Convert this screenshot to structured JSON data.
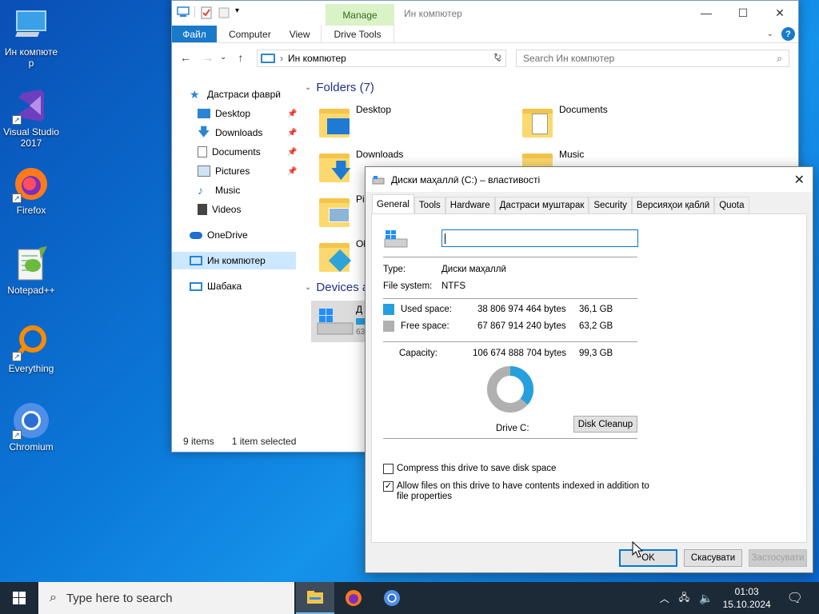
{
  "desktop": {
    "icons": [
      {
        "label": "Ин компюте\nр",
        "name": "this-pc"
      },
      {
        "label": "Visual Studio 2017",
        "name": "visual-studio"
      },
      {
        "label": "Firefox",
        "name": "firefox"
      },
      {
        "label": "Notepad++",
        "name": "notepadpp"
      },
      {
        "label": "Everything",
        "name": "everything"
      },
      {
        "label": "Chromium",
        "name": "chromium"
      }
    ]
  },
  "explorer": {
    "title": "Ин компютер",
    "manage_tab": "Manage",
    "ribbon": {
      "file": "Файл",
      "tabs": [
        "Computer",
        "View",
        "Drive Tools"
      ]
    },
    "address": "Ин компютер",
    "search_placeholder": "Search Ин компютер",
    "nav": {
      "quick_access": "Дастраси фаврӣ",
      "items": [
        "Desktop",
        "Downloads",
        "Documents",
        "Pictures",
        "Music",
        "Videos"
      ],
      "onedrive": "OneDrive",
      "this_pc": "Ин компютер",
      "network": "Шабака"
    },
    "folders_header": "Folders (7)",
    "folders": [
      "Desktop",
      "Documents",
      "Downloads",
      "Music",
      "Pi",
      "Oł"
    ],
    "devices_header": "Devices a",
    "drive_partial": "Д",
    "drive_partial2": "63",
    "status": {
      "items": "9 items",
      "selected": "1 item selected"
    }
  },
  "dialog": {
    "title": "Диски маҳаллӣ (C:) – властивості",
    "tabs": [
      "General",
      "Tools",
      "Hardware",
      "Дастраси муштарак",
      "Security",
      "Версияҳои қаблӣ",
      "Quota"
    ],
    "active_tab": "General",
    "name_value": "",
    "type_label": "Type:",
    "type_value": "Диски маҳаллӣ",
    "fs_label": "File system:",
    "fs_value": "NTFS",
    "used_label": "Used space:",
    "used_bytes": "38 806 974 464 bytes",
    "used_gb": "36,1 GB",
    "free_label": "Free space:",
    "free_bytes": "67 867 914 240 bytes",
    "free_gb": "63,2 GB",
    "cap_label": "Capacity:",
    "cap_bytes": "106 674 888 704 bytes",
    "cap_gb": "99,3 GB",
    "drive_label": "Drive C:",
    "cleanup": "Disk Cleanup",
    "used_fraction": 0.3638,
    "compress": "Compress this drive to save disk space",
    "index_line1": "Allow files on this drive to have contents indexed in addition to",
    "index_line2": "file properties",
    "ok": "OK",
    "cancel": "Скасувати",
    "apply": "Застосувати",
    "colors": {
      "used": "#269fdf",
      "free": "#b0b0b0"
    }
  },
  "taskbar": {
    "search_placeholder": "Type here to search",
    "time": "01:03",
    "date": "15.10.2024"
  }
}
